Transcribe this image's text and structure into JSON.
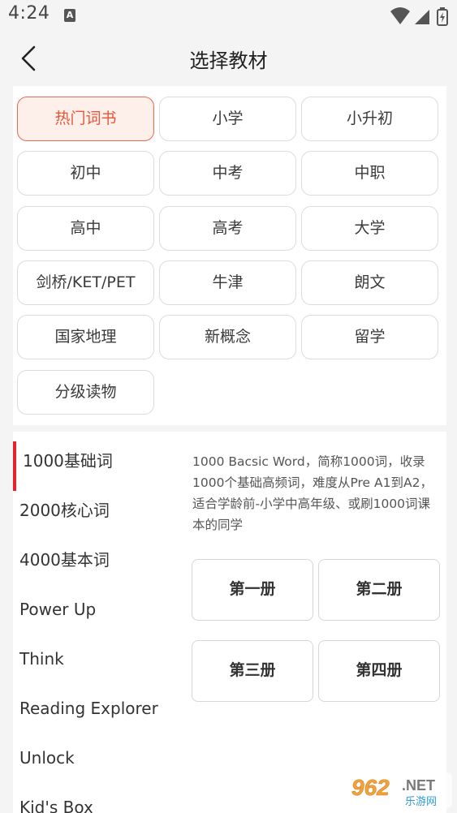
{
  "status_bar": {
    "time": "4:24",
    "notification_letter": "A"
  },
  "header": {
    "title": "选择教材"
  },
  "categories": [
    {
      "label": "热门词书",
      "active": true
    },
    {
      "label": "小学",
      "active": false
    },
    {
      "label": "小升初",
      "active": false
    },
    {
      "label": "初中",
      "active": false
    },
    {
      "label": "中考",
      "active": false
    },
    {
      "label": "中职",
      "active": false
    },
    {
      "label": "高中",
      "active": false
    },
    {
      "label": "高考",
      "active": false
    },
    {
      "label": "大学",
      "active": false
    },
    {
      "label": "剑桥/KET/PET",
      "active": false
    },
    {
      "label": "牛津",
      "active": false
    },
    {
      "label": "朗文",
      "active": false
    },
    {
      "label": "国家地理",
      "active": false
    },
    {
      "label": "新概念",
      "active": false
    },
    {
      "label": "留学",
      "active": false
    },
    {
      "label": "分级读物",
      "active": false
    }
  ],
  "series": [
    {
      "label": "1000基础词",
      "active": true
    },
    {
      "label": "2000核心词",
      "active": false
    },
    {
      "label": "4000基本词",
      "active": false
    },
    {
      "label": "Power Up",
      "active": false
    },
    {
      "label": "Think",
      "active": false
    },
    {
      "label": "Reading Explorer",
      "active": false
    },
    {
      "label": "Unlock",
      "active": false
    },
    {
      "label": "Kid's Box",
      "active": false
    }
  ],
  "detail": {
    "description": "1000 Bacsic Word，简称1000词，收录1000个基础高频词，难度从Pre A1到A2，适合学龄前-小学中高年级、或刷1000词课本的同学",
    "volumes": [
      "第一册",
      "第二册",
      "第三册",
      "第四册"
    ]
  },
  "watermark": {
    "brand": "962",
    "suffix": ".NET",
    "subtitle": "乐游网"
  },
  "colors": {
    "accent": "#e8553a",
    "accent_bg": "#fdefe9",
    "indicator": "#e8222a"
  }
}
